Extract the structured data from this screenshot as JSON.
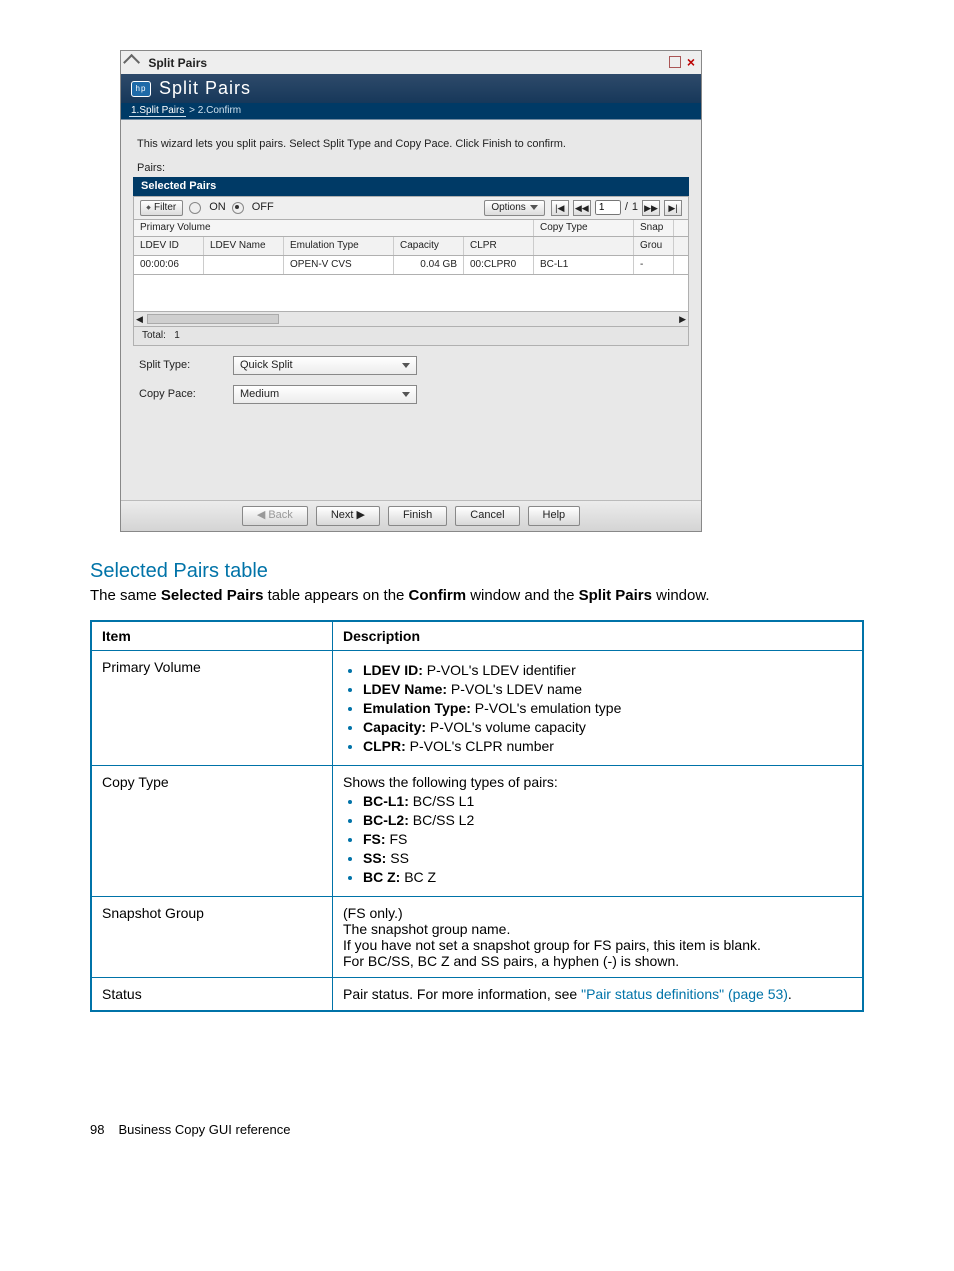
{
  "wizard": {
    "window_title": "Split Pairs",
    "header_title": "Split Pairs",
    "breadcrumbs": {
      "step1": "1.Split Pairs",
      "sep": ">",
      "step2": "2.Confirm"
    },
    "description": "This wizard lets you split pairs. Select Split Type and Copy Pace. Click Finish to confirm.",
    "pairs_label": "Pairs:",
    "selected_pairs_header": "Selected Pairs",
    "toolbar": {
      "filter_label": "Filter",
      "on_label": "ON",
      "off_label": "OFF",
      "options_label": "Options",
      "page_current": "1",
      "page_sep": "/",
      "page_total": "1"
    },
    "group_headers": {
      "primary_volume": "Primary Volume",
      "copy_type": "Copy Type",
      "snapshot_group": "Snap"
    },
    "columns": {
      "ldev_id": "LDEV ID",
      "ldev_name": "LDEV Name",
      "emulation_type": "Emulation Type",
      "capacity": "Capacity",
      "clpr": "CLPR",
      "snapshot_sub": "Grou"
    },
    "row": {
      "ldev_id": "00:00:06",
      "ldev_name": "",
      "emulation_type": "OPEN-V CVS",
      "capacity": "0.04 GB",
      "clpr": "00:CLPR0",
      "copy_type": "BC-L1",
      "snapshot": "-"
    },
    "total_label": "Total:",
    "total_value": "1",
    "form": {
      "split_type_label": "Split Type:",
      "split_type_value": "Quick Split",
      "copy_pace_label": "Copy Pace:",
      "copy_pace_value": "Medium"
    },
    "buttons": {
      "back": "Back",
      "next": "Next",
      "finish": "Finish",
      "cancel": "Cancel",
      "help": "Help"
    }
  },
  "section": {
    "title": "Selected Pairs table",
    "intro_parts": {
      "p1": "The same ",
      "b1": "Selected Pairs",
      "p2": " table appears on the ",
      "b2": "Confirm",
      "p3": " window and the ",
      "b3": "Split Pairs",
      "p4": " window."
    }
  },
  "desc_table": {
    "head_item": "Item",
    "head_desc": "Description",
    "rows": [
      {
        "item": "Primary Volume",
        "bullets": [
          {
            "b": "LDEV ID:",
            "t": " P-VOL's LDEV identifier"
          },
          {
            "b": "LDEV Name:",
            "t": " P-VOL's LDEV name"
          },
          {
            "b": "Emulation Type:",
            "t": " P-VOL's emulation type"
          },
          {
            "b": "Capacity:",
            "t": " P-VOL's volume capacity"
          },
          {
            "b": "CLPR:",
            "t": " P-VOL's CLPR number"
          }
        ]
      },
      {
        "item": "Copy Type",
        "lead": "Shows the following types of pairs:",
        "bullets": [
          {
            "b": "BC-L1:",
            "t": " BC/SS L1"
          },
          {
            "b": "BC-L2:",
            "t": " BC/SS L2"
          },
          {
            "b": "FS:",
            "t": " FS"
          },
          {
            "b": "SS:",
            "t": " SS"
          },
          {
            "b": "BC Z:",
            "t": " BC Z"
          }
        ]
      },
      {
        "item": "Snapshot Group",
        "lines": [
          "(FS only.)",
          "The snapshot group name.",
          "If you have not set a snapshot group for FS pairs, this item is blank.",
          "For BC/SS, BC Z and SS pairs, a hyphen (-) is shown."
        ]
      },
      {
        "item": "Status",
        "status_prefix": "Pair status. For more information, see ",
        "status_link": "\"Pair status definitions\" (page 53)",
        "status_suffix": "."
      }
    ]
  },
  "footer": {
    "page_number": "98",
    "chapter": "Business Copy GUI reference"
  }
}
